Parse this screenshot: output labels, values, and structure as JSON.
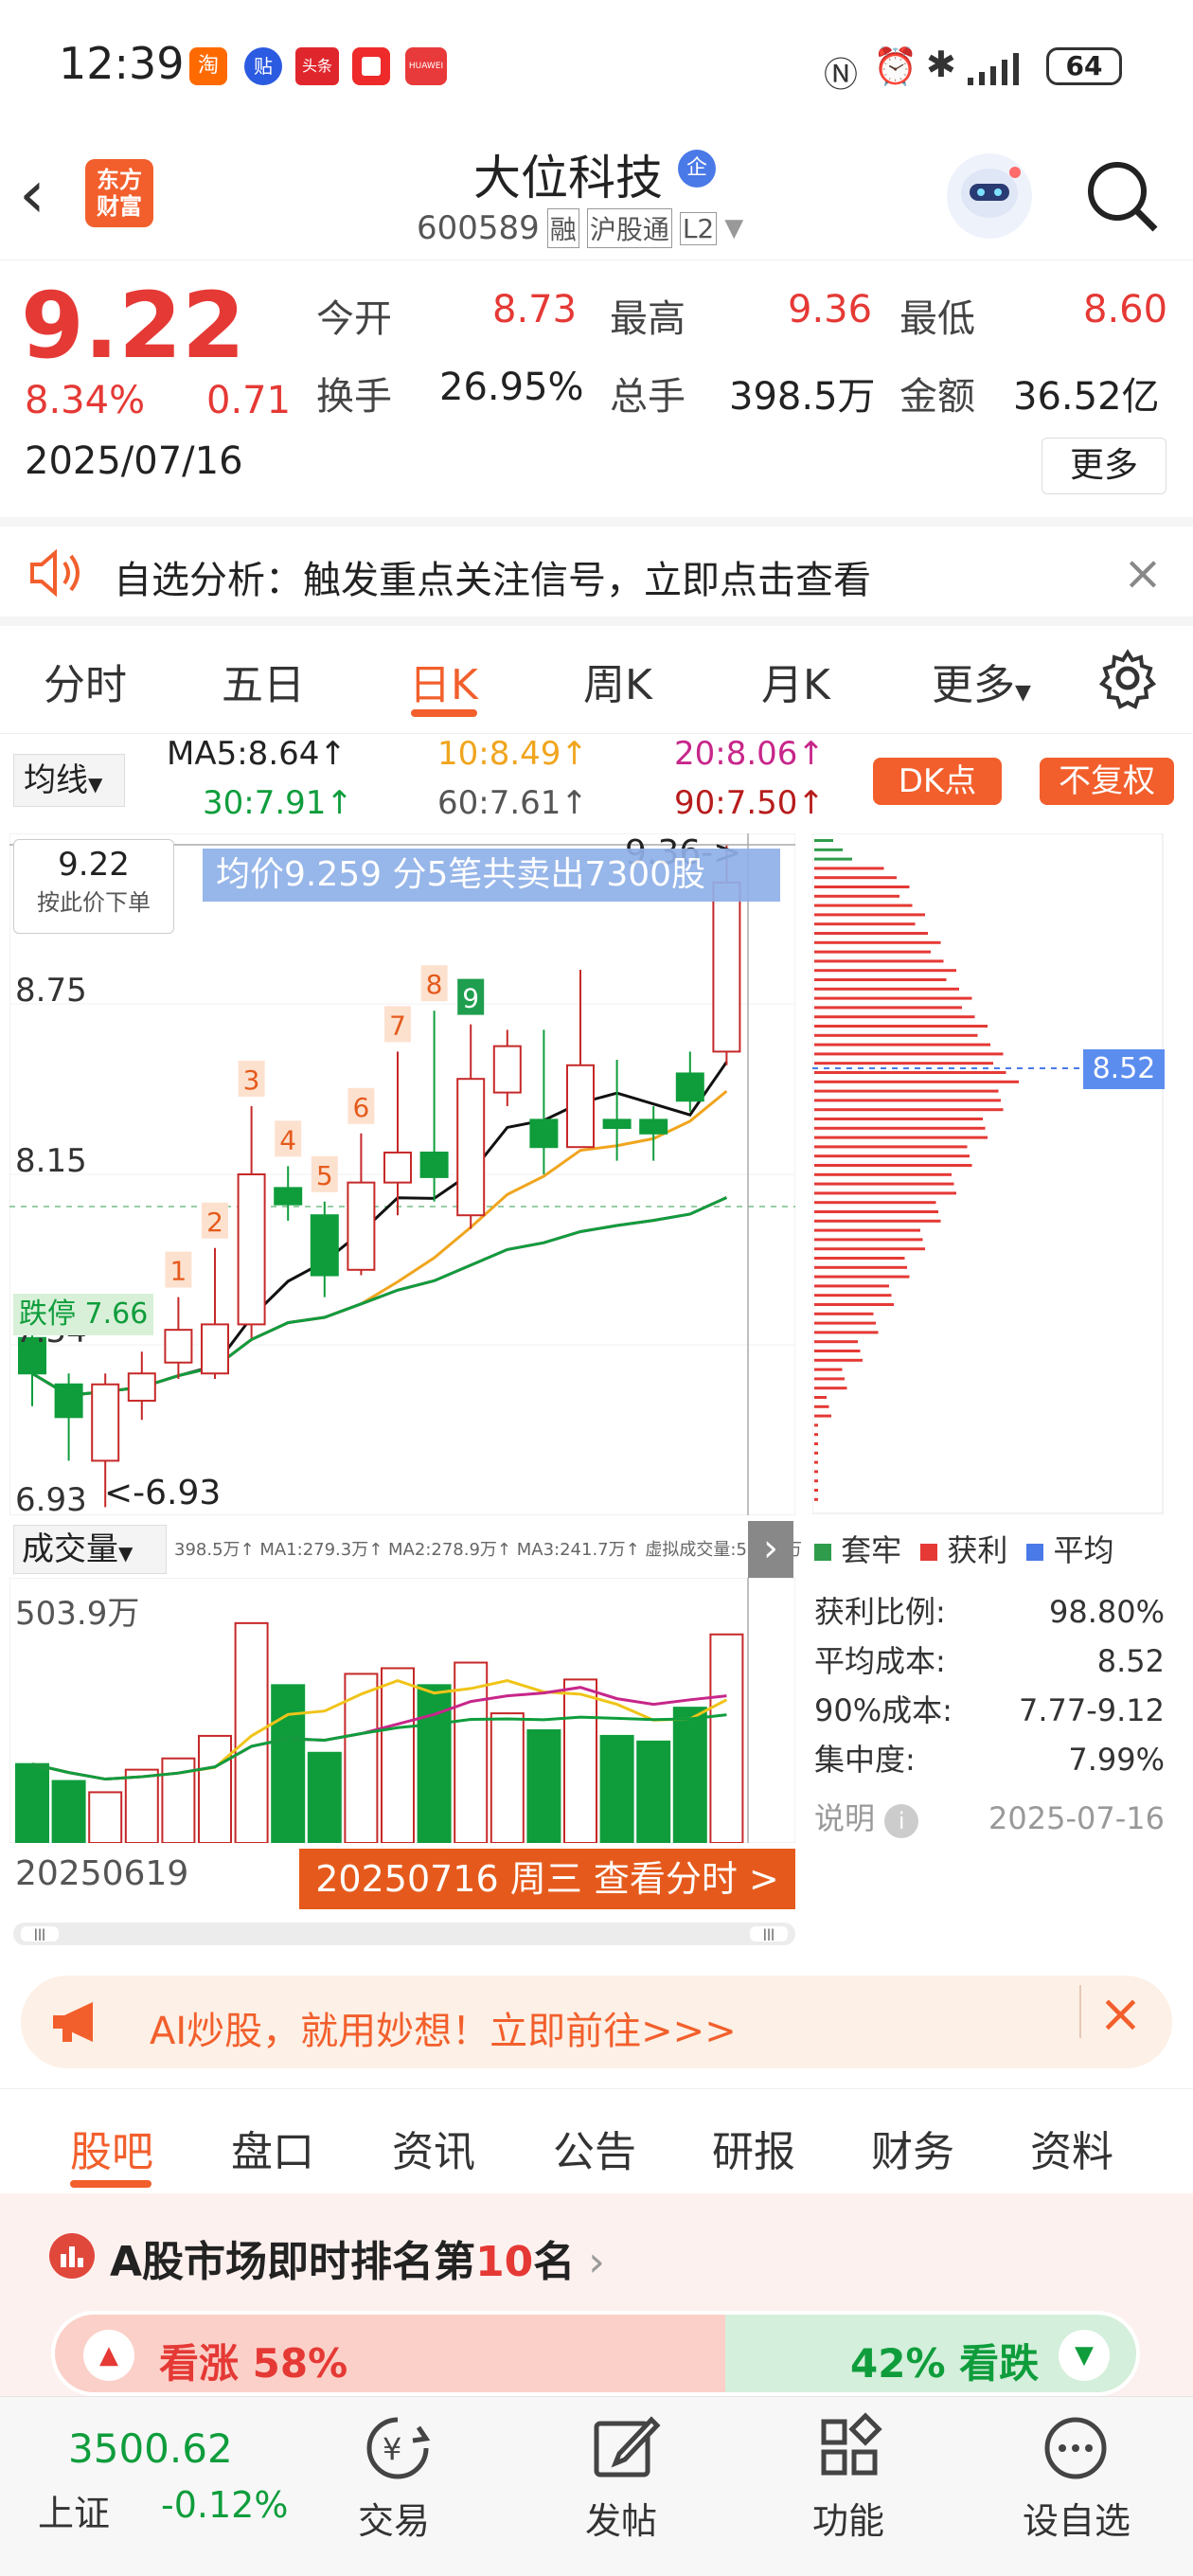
{
  "status_bar": {
    "time": "12:39",
    "battery": "64",
    "app_badges": [
      "淘",
      "贴",
      "头条",
      "",
      "HUAWEI"
    ]
  },
  "nav": {
    "logo_line1": "东方",
    "logo_line2": "财富",
    "stock_name": "大位科技",
    "enterprise_badge": "企",
    "code": "600589",
    "tags": [
      "融",
      "沪股通",
      "L2"
    ]
  },
  "quote": {
    "price": "9.22",
    "change_pct": "8.34%",
    "change": "0.71",
    "date": "2025/07/16",
    "stats": [
      {
        "label": "今开",
        "value": "8.73",
        "color": "red"
      },
      {
        "label": "最高",
        "value": "9.36",
        "color": "red"
      },
      {
        "label": "最低",
        "value": "8.60",
        "color": "red"
      },
      {
        "label": "换手",
        "value": "26.95%",
        "color": "dark"
      },
      {
        "label": "总手",
        "value": "398.5万",
        "color": "dark"
      },
      {
        "label": "金额",
        "value": "36.52亿",
        "color": "dark"
      }
    ],
    "more_label": "更多"
  },
  "alert": {
    "text": "自选分析：触发重点关注信号，立即点击查看"
  },
  "kline_tabs": [
    "分时",
    "五日",
    "日K",
    "周K",
    "月K",
    "更多"
  ],
  "indicator": {
    "selector": "均线",
    "ma5": "MA5:8.64",
    "ma10": "10:8.49",
    "ma20": "20:8.06",
    "ma30": "30:7.91",
    "ma60": "60:7.61",
    "ma90": "90:7.50",
    "dk_label": "DK点",
    "fq_label": "不复权"
  },
  "chart": {
    "price_box_value": "9.22",
    "price_box_hint": "按此价下单",
    "trade_banner": "均价9.259  分5笔共卖出7300股",
    "high_label": "9.36",
    "low_label": "6.93",
    "y_ticks": [
      "8.75",
      "8.15",
      "7.54",
      "6.93"
    ],
    "limit_down_label": "跌停",
    "limit_down_value": "7.66",
    "seq_marks": [
      "1",
      "2",
      "3",
      "4",
      "5",
      "6",
      "7",
      "8",
      "9"
    ]
  },
  "chip_panel": {
    "avg_price": "8.52",
    "legend": [
      "套牢",
      "获利",
      "平均"
    ],
    "rows": [
      {
        "label": "获利比例:",
        "value": "98.80%"
      },
      {
        "label": "平均成本:",
        "value": "8.52"
      },
      {
        "label": "90%成本:",
        "value": "7.77-9.12"
      },
      {
        "label": "集中度:",
        "value": "7.99%"
      }
    ],
    "note_label": "说明",
    "note_date": "2025-07-16"
  },
  "volume": {
    "selector": "成交量",
    "stats": "398.5万↑ MA1:279.3万↑ MA2:278.9万↑ MA3:241.7万↑ 虚拟成交量:503.9万",
    "max_label": "503.9万",
    "start_date": "20250619",
    "detail_button": "20250716 周三 查看分时 >"
  },
  "ad": {
    "text": "AI炒股，就用妙想！立即前往>>>"
  },
  "bottom_tabs": [
    "股吧",
    "盘口",
    "资讯",
    "公告",
    "研报",
    "财务",
    "资料"
  ],
  "rank": {
    "prefix": "A股市场即时排名第",
    "rank": "10",
    "suffix": "名",
    "up_label": "看涨 58%",
    "down_label": "42% 看跌"
  },
  "index": {
    "value": "3500.62",
    "name": "上证",
    "change": "-0.12%"
  },
  "bottom_nav": [
    "交易",
    "发帖",
    "功能",
    "设自选"
  ],
  "candles": [
    {
      "o": 7.55,
      "c": 7.42,
      "h": 7.6,
      "l": 7.3
    },
    {
      "o": 7.38,
      "c": 7.26,
      "h": 7.42,
      "l": 7.1
    },
    {
      "o": 7.1,
      "c": 7.38,
      "h": 7.42,
      "l": 6.93
    },
    {
      "o": 7.32,
      "c": 7.42,
      "h": 7.5,
      "l": 7.25
    },
    {
      "o": 7.46,
      "c": 7.58,
      "h": 7.7,
      "l": 7.4
    },
    {
      "o": 7.42,
      "c": 7.6,
      "h": 7.88,
      "l": 7.4
    },
    {
      "o": 7.6,
      "c": 8.15,
      "h": 8.4,
      "l": 7.55
    },
    {
      "o": 8.1,
      "c": 8.04,
      "h": 8.18,
      "l": 7.98
    },
    {
      "o": 8.0,
      "c": 7.78,
      "h": 8.05,
      "l": 7.7
    },
    {
      "o": 7.8,
      "c": 8.12,
      "h": 8.3,
      "l": 7.78
    },
    {
      "o": 8.12,
      "c": 8.23,
      "h": 8.6,
      "l": 8.0
    },
    {
      "o": 8.23,
      "c": 8.14,
      "h": 8.75,
      "l": 8.05
    },
    {
      "o": 8.0,
      "c": 8.5,
      "h": 8.7,
      "l": 7.95
    },
    {
      "o": 8.45,
      "c": 8.62,
      "h": 8.68,
      "l": 8.4
    },
    {
      "o": 8.35,
      "c": 8.25,
      "h": 8.68,
      "l": 8.15
    },
    {
      "o": 8.25,
      "c": 8.55,
      "h": 8.9,
      "l": 8.25
    },
    {
      "o": 8.35,
      "c": 8.32,
      "h": 8.57,
      "l": 8.2
    },
    {
      "o": 8.35,
      "c": 8.3,
      "h": 8.4,
      "l": 8.2
    },
    {
      "o": 8.52,
      "c": 8.42,
      "h": 8.6,
      "l": 8.38
    },
    {
      "o": 8.6,
      "c": 9.22,
      "h": 9.36,
      "l": 8.55
    }
  ],
  "volumes": [
    1.4,
    1.1,
    0.9,
    1.3,
    1.5,
    1.9,
    3.9,
    2.8,
    1.6,
    3.0,
    3.1,
    2.8,
    3.2,
    2.3,
    2.0,
    2.9,
    1.9,
    1.8,
    2.4,
    3.7
  ]
}
